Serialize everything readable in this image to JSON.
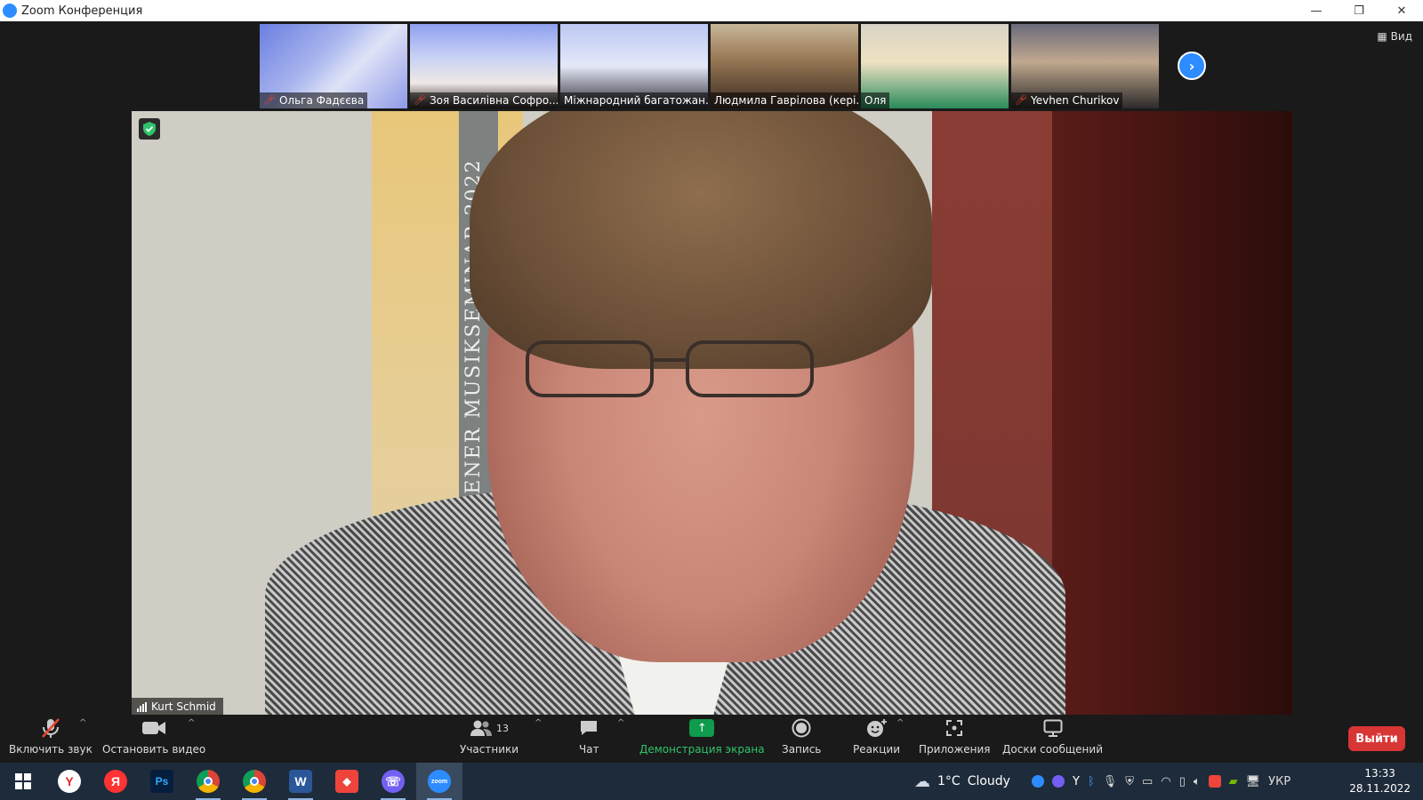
{
  "window": {
    "title": "Zoom Конференция",
    "controls": {
      "minimize": "—",
      "restore": "❐",
      "close": "✕"
    }
  },
  "view_button": {
    "label": "Вид",
    "icon": "grid-view-icon"
  },
  "thumbnails": [
    {
      "name": "Ольга Фадєєва",
      "muted": true
    },
    {
      "name": "Зоя Василівна Софро...",
      "muted": true
    },
    {
      "name": "Міжнародний багатожан...",
      "muted": false
    },
    {
      "name": "Людмила Гаврілова (кері...",
      "muted": false
    },
    {
      "name": "Оля",
      "muted": false
    },
    {
      "name": "Yevhen Churikov",
      "muted": true
    }
  ],
  "speaker": {
    "name": "Kurt Schmid",
    "poster_text": "WIENER MUSIKSEMINAR 2022"
  },
  "toolbar": {
    "mute_label": "Включить звук",
    "video_label": "Остановить видео",
    "participants_label": "Участники",
    "participants_count": "13",
    "chat_label": "Чат",
    "share_label": "Демонстрация экрана",
    "record_label": "Запись",
    "reactions_label": "Реакции",
    "apps_label": "Приложения",
    "whiteboards_label": "Доски сообщений",
    "leave_label": "Выйти"
  },
  "taskbar": {
    "weather_temp": "1°C",
    "weather_text": "Cloudy",
    "language": "УКР",
    "time": "13:33",
    "date": "28.11.2022",
    "apps": [
      "start",
      "yandex-browser",
      "yandex",
      "photoshop",
      "chrome-1",
      "chrome-2",
      "word",
      "anydesk",
      "viber",
      "zoom"
    ]
  },
  "colors": {
    "accent": "#2d8cff",
    "leave": "#d83535",
    "share": "#0e9b4b"
  }
}
